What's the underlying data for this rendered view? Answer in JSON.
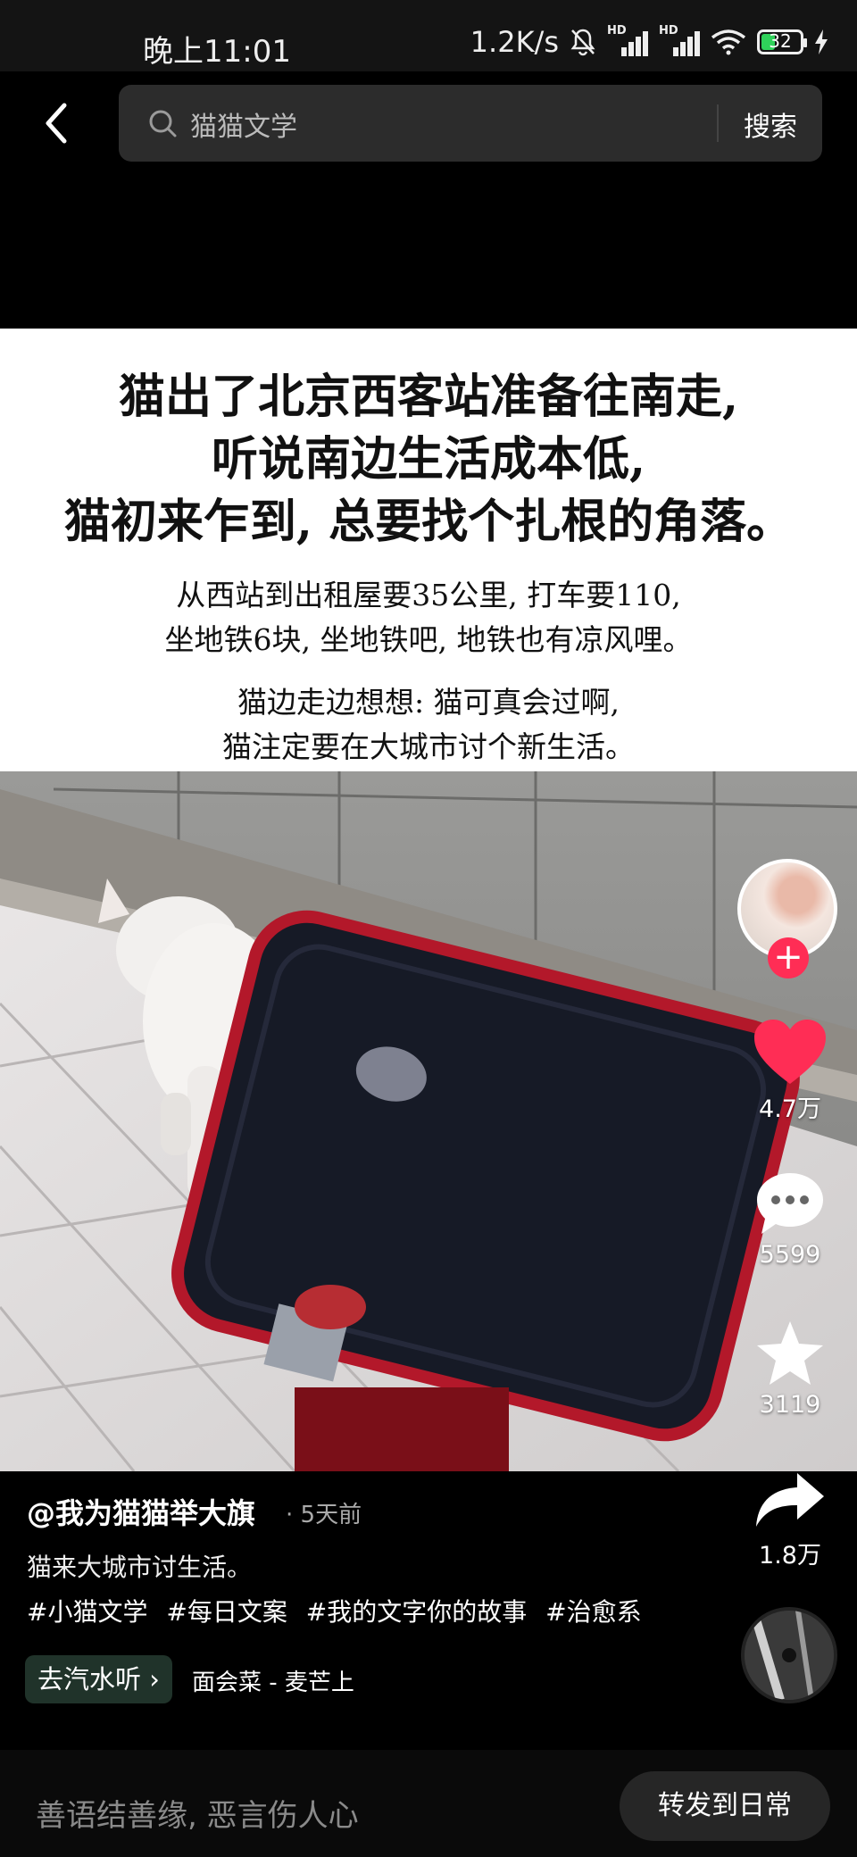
{
  "status_bar": {
    "time": "晚上11:01",
    "net_speed": "1.2K/s",
    "battery": "32",
    "icons": [
      "bell-off-icon",
      "hd-signal-icon",
      "hd-signal-icon",
      "wifi-icon",
      "battery-icon",
      "charging-icon"
    ]
  },
  "search": {
    "query": "猫猫文学",
    "button": "搜索"
  },
  "post_text": {
    "headline": [
      "猫出了北京西客站准备往南走,",
      "听说南边生活成本低,",
      "猫初来乍到, 总要找个扎根的角落。"
    ],
    "paragraph1": [
      "从西站到出租屋要35公里, 打车要110,",
      "坐地铁6块, 坐地铁吧, 地铁也有凉风哩。"
    ],
    "paragraph2": [
      "猫边走边想想: 猫可真会过啊,",
      "猫注定要在大城市讨个新生活。"
    ]
  },
  "rail": {
    "likes": "4.7万",
    "comments": "5599",
    "favorites": "3119",
    "shares": "1.8万"
  },
  "info": {
    "author": "@我为猫猫举大旗",
    "time_ago": "· 5天前",
    "caption": "猫来大城市讨生活。",
    "tags": [
      "#小猫文学",
      "#每日文案",
      "#我的文字你的故事",
      "#治愈系"
    ],
    "music_tag": "去汽水听",
    "song": "面会菜 - 麦芒上"
  },
  "comment_bar": {
    "placeholder": "善语结善缘, 恶言伤人心",
    "forward": "转发到日常"
  },
  "colors": {
    "like": "#ff2d55",
    "follow": "#ff2d55",
    "search_bg": "#2c2c2c"
  }
}
